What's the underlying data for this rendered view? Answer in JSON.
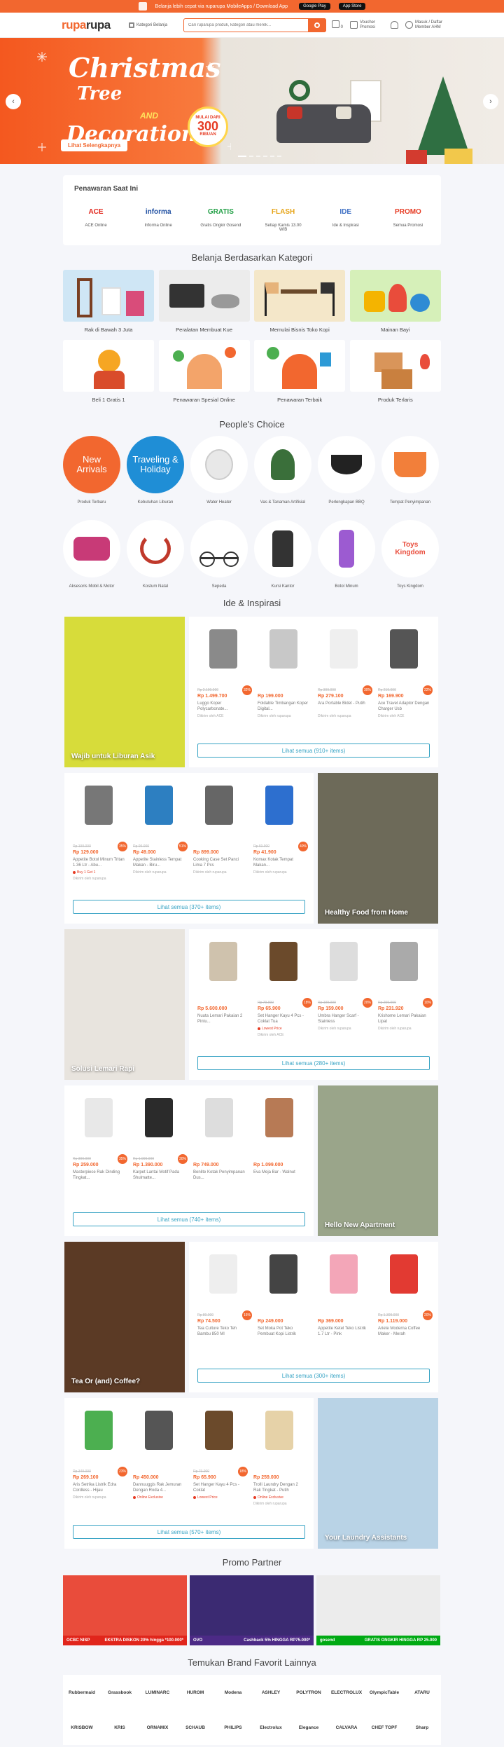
{
  "topbar": {
    "text": "Belanja lebih cepat via ruparupa MobileApps / Download App",
    "google": "Google Play",
    "apple": "App Store"
  },
  "header": {
    "logo_a": "rupa",
    "logo_b": "rupa",
    "category_label": "Kategori Belanja",
    "search_placeholder": "Cari ruparupa produk, kategori atau merek...",
    "cart_count": "0",
    "voucher": "Voucher Promosi",
    "account_top": "Masuk / Daftar",
    "account_bottom": "Member AHM"
  },
  "hero": {
    "line1": "Christmas",
    "line2": "Tree",
    "and": "AND",
    "line3": "Decorations",
    "badge_top": "MULAI DARI",
    "badge_value": "300",
    "badge_bottom": "RIBUAN",
    "cta": "Lihat Selengkapnya"
  },
  "offers": {
    "title": "Penawaran Saat Ini",
    "items": [
      {
        "label": "ACE Online",
        "logo": "ACE",
        "color": "#e1251b"
      },
      {
        "label": "Informa Online",
        "logo": "informa",
        "color": "#1e4ea1"
      },
      {
        "label": "Gratis Ongkir Gosend",
        "logo": "GRATIS",
        "color": "#22a046"
      },
      {
        "label": "Setiap Kamis 13.00 WIB",
        "logo": "FLASH",
        "color": "#e6a417"
      },
      {
        "label": "Ide & Inspirasi",
        "logo": "IDE",
        "color": "#3d6fc4"
      },
      {
        "label": "Semua Promosi",
        "logo": "PROMO",
        "color": "#e63b23"
      }
    ]
  },
  "categories": {
    "title": "Belanja Berdasarkan Kategori",
    "items": [
      {
        "label": "Rak di Bawah 3 Juta",
        "bg": "#cfe6f5"
      },
      {
        "label": "Peralatan Membuat Kue",
        "bg": "#ececec"
      },
      {
        "label": "Memulai Bisnis Toko Kopi",
        "bg": "#f4e7c9"
      },
      {
        "label": "Mainan Bayi",
        "bg": "#d6f0b9"
      },
      {
        "label": "Beli 1 Gratis 1",
        "bg": "#ffffff"
      },
      {
        "label": "Penawaran Spesial Online",
        "bg": "#ffffff"
      },
      {
        "label": "Penawaran Terbaik",
        "bg": "#ffffff"
      },
      {
        "label": "Produk Terlaris",
        "bg": "#ffffff"
      }
    ]
  },
  "peoples_choice": {
    "title": "People's Choice",
    "items": [
      {
        "label": "Produk Terbaru",
        "text": "New Arrivals",
        "bg": "#f2672f"
      },
      {
        "label": "Kebutuhan Liburan",
        "text": "Traveling & Holiday",
        "bg": "#1f8ed6"
      },
      {
        "label": "Water Heater",
        "text": "",
        "bg": "#ffffff"
      },
      {
        "label": "Vas & Tanaman Artifisial",
        "text": "",
        "bg": "#ffffff"
      },
      {
        "label": "Perlengkapan BBQ",
        "text": "",
        "bg": "#ffffff"
      },
      {
        "label": "Tempat Penyimpanan",
        "text": "",
        "bg": "#ffffff"
      },
      {
        "label": "Aksesoris Mobil & Motor",
        "text": "",
        "bg": "#ffffff"
      },
      {
        "label": "Kostum Natal",
        "text": "",
        "bg": "#ffffff"
      },
      {
        "label": "Sepeda",
        "text": "",
        "bg": "#ffffff"
      },
      {
        "label": "Kursi Kantor",
        "text": "",
        "bg": "#ffffff"
      },
      {
        "label": "Botol Minum",
        "text": "",
        "bg": "#ffffff"
      },
      {
        "label": "Toys Kingdom",
        "text": "",
        "bg": "#ffffff"
      }
    ]
  },
  "ideas": {
    "title": "Ide & Inspirasi",
    "blocks": [
      {
        "caption": "Wajib untuk Liburan Asik",
        "see_all": "Lihat semua (910+ items)",
        "bg": "#d7dc3a",
        "products": [
          {
            "orig": "Rp 2.199.000",
            "price": "Rp 1.499.700",
            "name": "Luggo Koper Polycarbonate...",
            "disc": "32%",
            "tag": "",
            "seller": "Dikirim oleh ACE"
          },
          {
            "orig": "",
            "price": "Rp 199.000",
            "name": "Foldable Timbangan Koper Digital...",
            "disc": "",
            "tag": "",
            "seller": "Dikirim oleh ruparupa"
          },
          {
            "orig": "Rp 399.000",
            "price": "Rp 279.100",
            "name": "Ara Portable Bidet - Putih",
            "disc": "30%",
            "tag": "",
            "seller": "Dikirim oleh ruparupa"
          },
          {
            "orig": "Rp 219.000",
            "price": "Rp 169.900",
            "name": "Ace Travel Adaptor Dengan Charger Usb",
            "disc": "22%",
            "tag": "",
            "seller": "Dikirim oleh ACE"
          }
        ]
      },
      {
        "caption": "Healthy Food from Home",
        "see_all": "Lihat semua (370+ items)",
        "bg": "#6d6a59",
        "products": [
          {
            "orig": "Rp 199.000",
            "price": "Rp 129.000",
            "name": "Appetite Botol Minum Tritan 1.36 Ltr - Abu...",
            "disc": "35%",
            "tag": "Buy 1 Get 1",
            "seller": "Dikirim oleh ruparupa"
          },
          {
            "orig": "Rp 99.900",
            "price": "Rp 49.000",
            "name": "Appetite Stainless Tempat Makan - Biru...",
            "disc": "51%",
            "tag": "",
            "seller": "Dikirim oleh ruparupa"
          },
          {
            "orig": "",
            "price": "Rp 899.000",
            "name": "Cooking Case Set Panci Lima 7 Pcs",
            "disc": "",
            "tag": "",
            "seller": "Dikirim oleh ruparupa"
          },
          {
            "orig": "Rp 69.900",
            "price": "Rp 41.900",
            "name": "Komax Kotak Tempat Makan...",
            "disc": "40%",
            "tag": "",
            "seller": "Dikirim oleh ruparupa"
          }
        ]
      },
      {
        "caption": "Solusi Lemari Rapi",
        "see_all": "Lihat semua (280+ items)",
        "bg": "#e8e4de",
        "products": [
          {
            "orig": "",
            "price": "Rp 5.600.000",
            "name": "Nuuta Lemari Pakaian 2 Pintu...",
            "disc": "",
            "tag": "",
            "seller": ""
          },
          {
            "orig": "Rp 79.900",
            "price": "Rp 65.900",
            "name": "Set Hanger Kayu 4 Pcs - Coklat Tua",
            "disc": "18%",
            "tag": "Lowest Price",
            "seller": "Dikirim oleh ACE"
          },
          {
            "orig": "Rp 199.000",
            "price": "Rp 159.000",
            "name": "Umbra Hanger Scarf - Stainless",
            "disc": "20%",
            "tag": "",
            "seller": "Dikirim oleh ruparupa"
          },
          {
            "orig": "Rp 259.000",
            "price": "Rp 231.920",
            "name": "Krishome Lemari Pakaian Lipat",
            "disc": "10%",
            "tag": "",
            "seller": "Dikirim oleh ruparupa"
          }
        ]
      },
      {
        "caption": "Hello New Apartment",
        "see_all": "Lihat semua (740+ items)",
        "bg": "#9aa58a",
        "products": [
          {
            "orig": "Rp 399.000",
            "price": "Rp 259.000",
            "name": "Masterpiece Rak Dinding Tingkat...",
            "disc": "35%",
            "tag": "",
            "seller": ""
          },
          {
            "orig": "Rp 1.999.000",
            "price": "Rp 1.390.000",
            "name": "Karpet Lantai Motif Pada Shulmatte...",
            "disc": "30%",
            "tag": "",
            "seller": ""
          },
          {
            "orig": "",
            "price": "Rp 749.000",
            "name": "Benlite Kotak Penyimpanan Dus...",
            "disc": "",
            "tag": "",
            "seller": ""
          },
          {
            "orig": "",
            "price": "Rp 1.099.000",
            "name": "Eva Meja Bar - Walnut",
            "disc": "",
            "tag": "",
            "seller": ""
          }
        ]
      },
      {
        "caption": "Tea Or (and) Coffee?",
        "see_all": "Lihat semua (300+ items)",
        "bg": "#5b3a25",
        "products": [
          {
            "orig": "Rp 89.000",
            "price": "Rp 74.500",
            "name": "Tea Culture Teko Teh Bambu 850 Ml",
            "disc": "16%",
            "tag": "",
            "seller": ""
          },
          {
            "orig": "",
            "price": "Rp 249.000",
            "name": "Set Moka Pot Teko Pembuat Kopi Listrik",
            "disc": "",
            "tag": "",
            "seller": ""
          },
          {
            "orig": "",
            "price": "Rp 369.000",
            "name": "Appetite Ketel Teko Listrik 1.7 Ltr - Pink",
            "disc": "",
            "tag": "",
            "seller": ""
          },
          {
            "orig": "Rp 1.399.000",
            "price": "Rp 1.119.000",
            "name": "Ariete Moderna Coffee Maker - Merah",
            "disc": "20%",
            "tag": "",
            "seller": ""
          }
        ]
      },
      {
        "caption": "Your Laundry Assistants",
        "see_all": "Lihat semua (570+ items)",
        "bg": "#b9d3e6",
        "products": [
          {
            "orig": "Rp 349.000",
            "price": "Rp 269.100",
            "name": "Aris Setrika Listrik Edra Cordless - Hijau",
            "disc": "23%",
            "tag": "",
            "seller": "Dikirim oleh ruparupa"
          },
          {
            "orig": "",
            "price": "Rp 450.000",
            "name": "Dannuuggis Rak Jemuran Dengan Roda 4...",
            "disc": "",
            "tag": "Online Exclusive",
            "seller": ""
          },
          {
            "orig": "Rp 79.900",
            "price": "Rp 65.900",
            "name": "Set Hanger Kayu 4 Pcs - Coklat",
            "disc": "18%",
            "tag": "Lowest Price",
            "seller": ""
          },
          {
            "orig": "",
            "price": "Rp 259.000",
            "name": "Trolli Laundry Dengan 2 Rak Tingkat - Putih",
            "disc": "",
            "tag": "Online Exclusive",
            "seller": "Dikirim oleh ruparupa"
          }
        ]
      }
    ]
  },
  "promo": {
    "title": "Promo Partner",
    "cards": [
      {
        "brand": "OCBC NISP",
        "deal": "EKSTRA DISKON 20% hingga *100.000*",
        "bg": "#e94c3b",
        "foot": "#e1251b"
      },
      {
        "brand": "OVO",
        "deal": "Cashback 5% HINGGA RP75.000*",
        "bg": "#3b2a72",
        "foot": "#4c2a86"
      },
      {
        "brand": "gosend",
        "deal": "GRATIS ONGKIR HINGGA RP 25.000",
        "bg": "#ececec",
        "foot": "#00aa13"
      }
    ]
  },
  "brands": {
    "title": "Temukan Brand Favorit Lainnya",
    "items": [
      "Rubbermaid",
      "Grassbook",
      "LUMINARC",
      "HUROM",
      "Modena",
      "ASHLEY",
      "POLYTRON",
      "ELECTROLUX",
      "OlympicTable",
      "ATARU",
      "KRISBOW",
      "KRIS",
      "ORNAMIX",
      "SCHAUB",
      "PHILIPS",
      "Electrolux",
      "Elegance",
      "CALVARA",
      "CHEF TOPF",
      "Sharp"
    ]
  }
}
